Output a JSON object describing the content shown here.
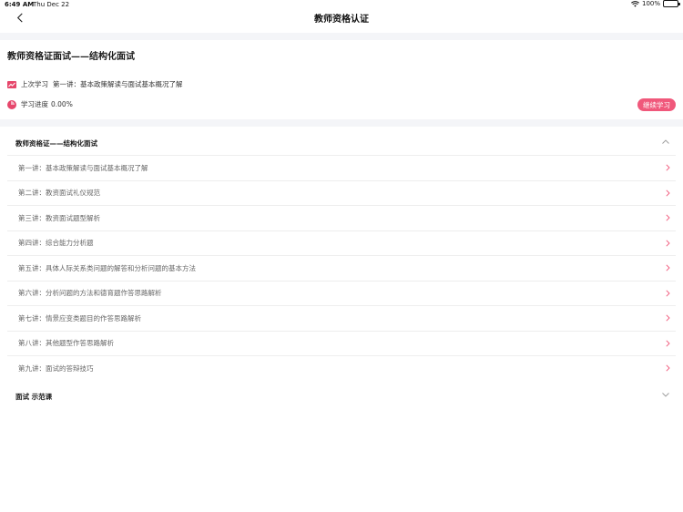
{
  "status": {
    "time": "6:49 AM",
    "date": "Thu Dec 22",
    "battery": "100%"
  },
  "nav": {
    "title": "教师资格认证"
  },
  "course": {
    "title": "教师资格证面试——结构化面试",
    "last_label": "上次学习",
    "last_lesson": "第一讲：基本政策解读与面试基本概况了解",
    "progress_label": "学习进度",
    "progress_value": "0.00%",
    "continue_label": "继续学习"
  },
  "sections": [
    {
      "title": "教师资格证——结构化面试",
      "expanded": true,
      "lessons": [
        "第一讲：基本政策解读与面试基本概况了解",
        "第二讲：教资面试礼仪规范",
        "第三讲：教资面试题型解析",
        "第四讲：综合能力分析题",
        "第五讲：具体人际关系类问题的解答和分析问题的基本方法",
        "第六讲：分析问题的方法和德育题作答思路解析",
        "第七讲：情景应变类题目的作答思路解析",
        "第八讲：其他题型作答思路解析",
        "第九讲：面试的答辩技巧"
      ]
    },
    {
      "title": "面试 示范课",
      "expanded": false,
      "lessons": []
    }
  ],
  "colors": {
    "accent": "#f0587b",
    "icon": "#e6466b",
    "separator": "#f4f5f8"
  }
}
